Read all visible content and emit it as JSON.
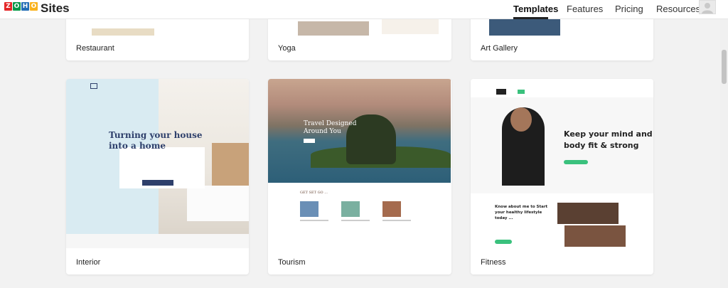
{
  "header": {
    "logo_letters": [
      "Z",
      "O",
      "H",
      "O"
    ],
    "logo_colors": [
      "#e42527",
      "#089949",
      "#226db4",
      "#f9b21d"
    ],
    "brand": "Sites",
    "nav": [
      "Templates",
      "Features",
      "Pricing",
      "Resources"
    ],
    "active_nav": "Templates"
  },
  "templates_top": [
    "Restaurant",
    "Yoga",
    "Art Gallery"
  ],
  "templates": [
    {
      "name": "Interior",
      "preview": {
        "heading_line1": "Turning your house",
        "heading_line2": "into a home"
      }
    },
    {
      "name": "Tourism",
      "preview": {
        "heading_line1": "Travel Designed",
        "heading_line2": "Around You",
        "section_label": "GET SET GO ..."
      }
    },
    {
      "name": "Fitness",
      "preview": {
        "heading_line1": "Keep your mind and",
        "heading_line2": "body fit & strong",
        "section_line1": "Know about me to Start",
        "section_line2": "your healthy lifestyle",
        "section_line3": "today ..."
      }
    }
  ],
  "colors": {
    "interior_navy": "#2e3f6b",
    "fitness_green": "#3ac17d"
  }
}
